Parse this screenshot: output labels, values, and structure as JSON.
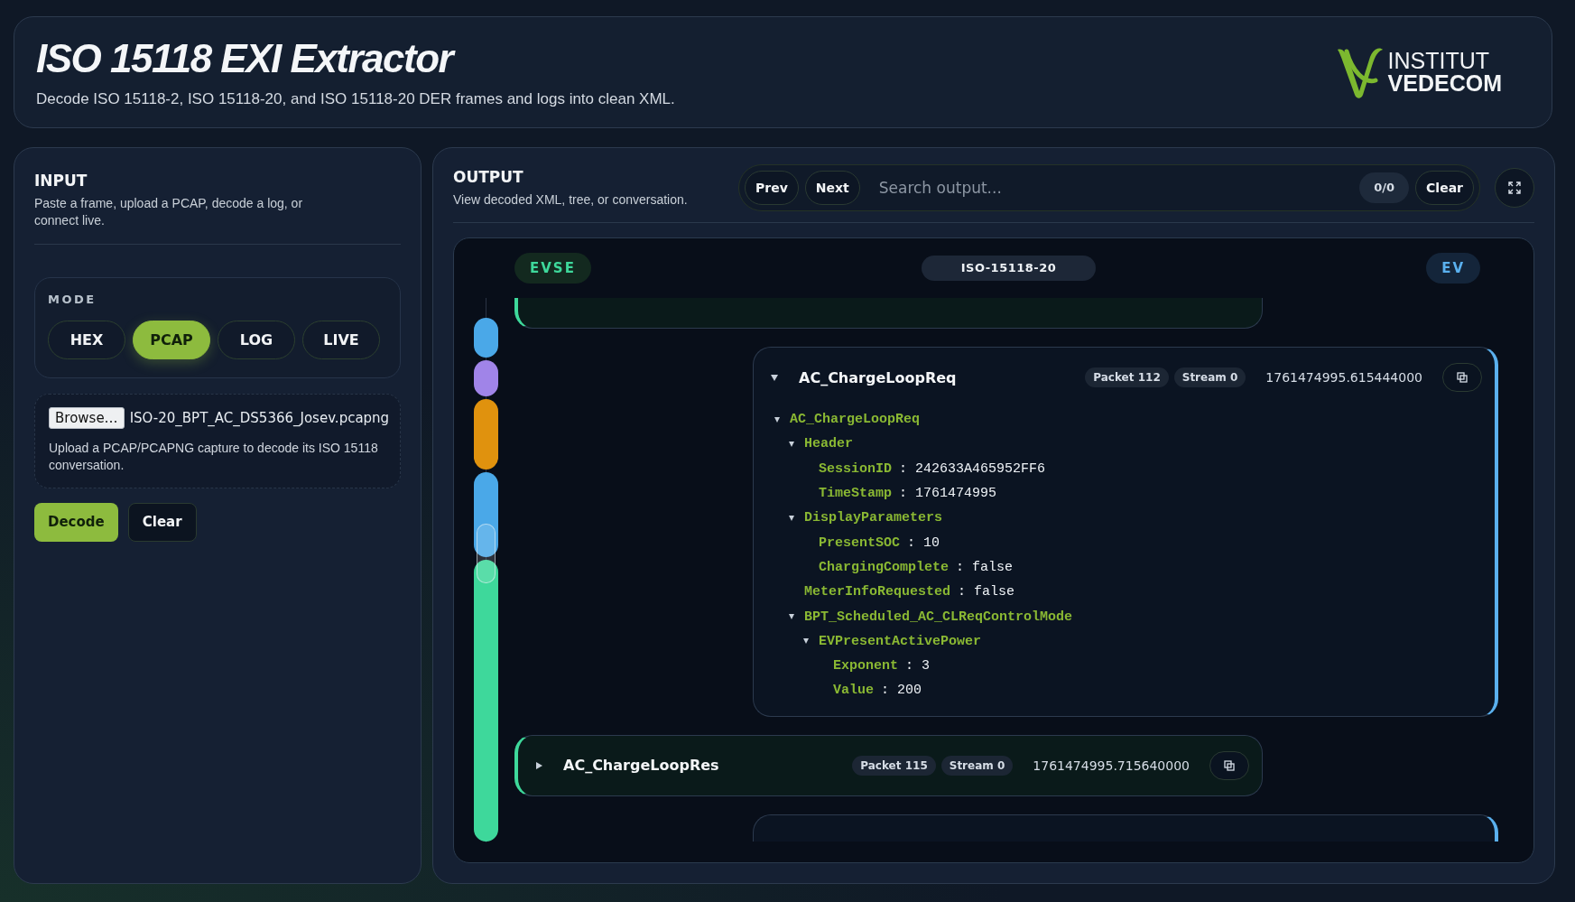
{
  "header": {
    "title": "ISO 15118 EXI Extractor",
    "subtitle": "Decode ISO 15118-2, ISO 15118-20, and ISO 15118-20 DER frames and logs into clean XML.",
    "logo": {
      "line1": "INSTITUT",
      "line2": "VEDECOM"
    }
  },
  "input": {
    "title": "INPUT",
    "description": "Paste a frame, upload a PCAP, decode a log, or connect live.",
    "mode_label": "MODE",
    "modes": [
      {
        "label": "HEX",
        "selected": false
      },
      {
        "label": "PCAP",
        "selected": true
      },
      {
        "label": "LOG",
        "selected": false
      },
      {
        "label": "LIVE",
        "selected": false
      }
    ],
    "file": {
      "button": "Browse…",
      "name": "ISO-20_BPT_AC_DS5366_Josev.pcapng",
      "hint": "Upload a PCAP/PCAPNG capture to decode its ISO 15118 conversation."
    },
    "buttons": [
      "Decode",
      "Clear"
    ]
  },
  "output": {
    "title": "OUTPUT",
    "description": "View decoded XML, tree, or conversation.",
    "prev": "Prev",
    "next": "Next",
    "search": {
      "placeholder": "Search output..."
    },
    "match_count": "0/0",
    "clear": "Clear",
    "conversation": {
      "left_label": "EVSE",
      "protocol": "ISO-15118-20",
      "right_label": "EV",
      "timeline": [
        {
          "color": "#4aa8e8"
        },
        {
          "color": "#a084e8"
        },
        {
          "color": "#e0920e"
        },
        {
          "color": "#4aa8e8"
        },
        {
          "color": "#3ed89b"
        }
      ],
      "messages": [
        {
          "kind": "res",
          "clipped_top": true
        },
        {
          "kind": "req",
          "expanded": true,
          "title": "AC_ChargeLoopReq",
          "packet": "Packet 112",
          "stream": "Stream 0",
          "time": "1761474995.615444000",
          "tree": [
            {
              "name": "AC_ChargeLoopReq",
              "expanded": true,
              "children": [
                {
                  "name": "Header",
                  "expanded": true,
                  "children": [
                    {
                      "name": "SessionID",
                      "value": ": 242633A465952FF6"
                    },
                    {
                      "name": "TimeStamp",
                      "value": ": 1761474995"
                    }
                  ]
                },
                {
                  "name": "DisplayParameters",
                  "expanded": true,
                  "children": [
                    {
                      "name": "PresentSOC",
                      "value": ": 10"
                    },
                    {
                      "name": "ChargingComplete",
                      "value": ": false"
                    }
                  ]
                },
                {
                  "name": "MeterInfoRequested",
                  "value": ": false"
                },
                {
                  "name": "BPT_Scheduled_AC_CLReqControlMode",
                  "expanded": true,
                  "children": [
                    {
                      "name": "EVPresentActivePower",
                      "expanded": true,
                      "children": [
                        {
                          "name": "Exponent",
                          "value": ": 3"
                        },
                        {
                          "name": "Value",
                          "value": ": 200"
                        }
                      ]
                    }
                  ]
                }
              ]
            }
          ]
        },
        {
          "kind": "res",
          "expanded": false,
          "title": "AC_ChargeLoopRes",
          "packet": "Packet 115",
          "stream": "Stream 0",
          "time": "1761474995.715640000"
        },
        {
          "kind": "req",
          "clipped_bottom": true
        }
      ]
    }
  }
}
